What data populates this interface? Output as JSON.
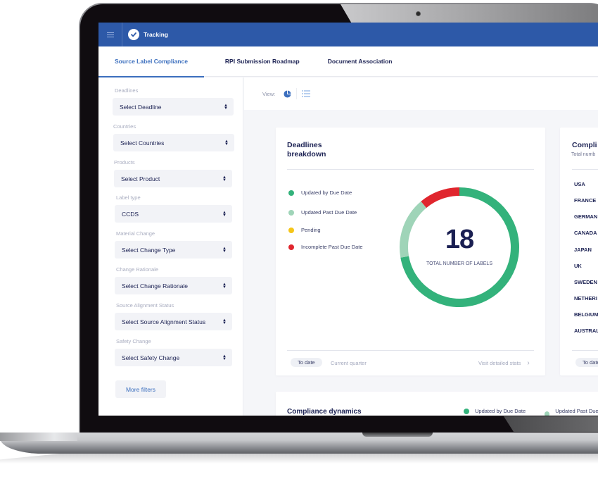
{
  "app": {
    "title": "Tracking",
    "menu_icon": "hamburger-menu-icon",
    "logo_icon": "check-circle-icon"
  },
  "tabs": [
    {
      "label": "Source Label Compliance",
      "active": true
    },
    {
      "label": "RPI Submission Roadmap",
      "active": false
    },
    {
      "label": "Document Association",
      "active": false
    }
  ],
  "filters": [
    {
      "label": "Deadlines",
      "value": "Select Deadline"
    },
    {
      "label": "Countries",
      "value": "Select Countries"
    },
    {
      "label": "Products",
      "value": "Select Product"
    },
    {
      "label": "Label type",
      "value": "CCDS"
    },
    {
      "label": "Material Change",
      "value": "Select Change Type"
    },
    {
      "label": "Change Rationale",
      "value": "Select Change Rationale"
    },
    {
      "label": "Source Alignment Status",
      "value": "Select Source Alignment Status"
    },
    {
      "label": "Safety Change",
      "value": "Select Safety Change"
    }
  ],
  "more_filters_label": "More filters",
  "view": {
    "label": "View:",
    "options": [
      {
        "icon": "pie-chart-icon",
        "active": true
      },
      {
        "icon": "list-icon",
        "active": false
      }
    ]
  },
  "deadlines_card": {
    "title_line1": "Deadlines",
    "title_line2": "breakdown",
    "legend": [
      {
        "label": "Updated by Due Date",
        "color": "#33b27b"
      },
      {
        "label": "Updated Past Due Date",
        "color": "#9fd4b8"
      },
      {
        "label": "Pending",
        "color": "#f5c518"
      },
      {
        "label": "Incomplete Past Due Date",
        "color": "#e0262e"
      }
    ],
    "total": "18",
    "total_caption": "TOTAL NUMBER OF LABELS",
    "period_active": "To date",
    "period_other": "Current quarter",
    "details_link": "Visit detailed stats",
    "details_arrow": "›"
  },
  "chart_data": {
    "type": "pie",
    "title": "Deadlines breakdown",
    "categories": [
      "Updated by Due Date",
      "Updated Past Due Date",
      "Pending",
      "Incomplete Past Due Date"
    ],
    "values": [
      13,
      3,
      0,
      2
    ],
    "colors": [
      "#33b27b",
      "#9fd4b8",
      "#f5c518",
      "#e0262e"
    ],
    "total": 18,
    "legend": "left"
  },
  "compliance_card": {
    "title": "Compli",
    "subtitle": "Total numb",
    "countries": [
      "USA",
      "FRANCE",
      "GERMAN",
      "CANADA",
      "JAPAN",
      "UK",
      "SWEDEN",
      "NETHERI",
      "BELGIUM",
      "AUSTRAL"
    ],
    "period_active": "To date"
  },
  "dynamics_card": {
    "title": "Compliance dynamics",
    "legend": [
      {
        "label": "Updated by Due Date",
        "color": "#33b27b"
      },
      {
        "label": "Updated Past Due D",
        "color": "#9fd4b8"
      }
    ]
  }
}
